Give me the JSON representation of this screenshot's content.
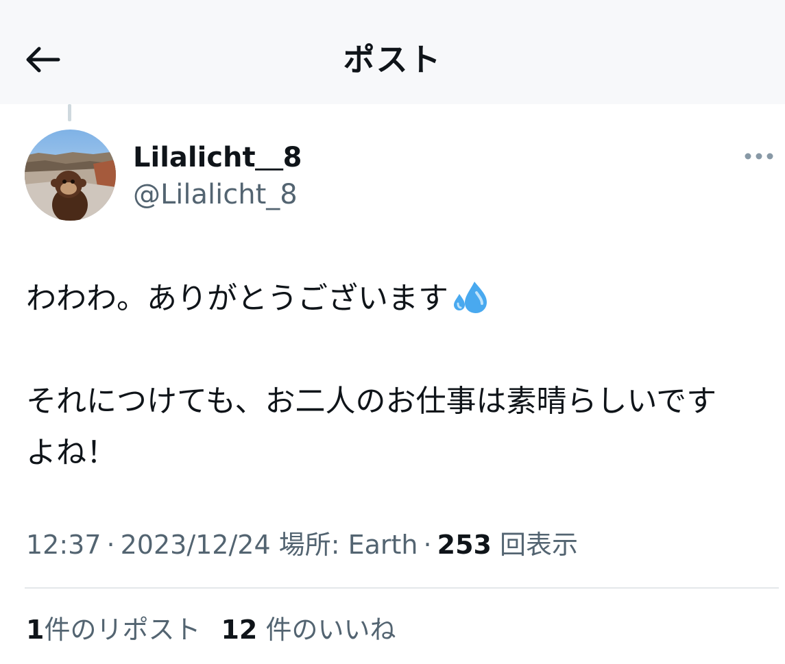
{
  "header": {
    "back_icon": "arrow-left-icon",
    "title": "ポスト"
  },
  "post": {
    "author": {
      "display_name": "Lilalicht＿8",
      "handle": "@Lilalicht_8",
      "avatar": "monkey-plush-at-canyon"
    },
    "more_icon": "more-horizontal-icon",
    "text_lines": [
      "わわわ。ありがとうございます",
      "",
      "それにつけても、お二人のお仕事は素晴らしいです",
      "よね！"
    ],
    "emoji": "sweat-droplets-emoji",
    "meta": {
      "time": "12:37",
      "separator": "·",
      "date": "2023/12/24",
      "location_label": "場所: Earth",
      "views_count": "253",
      "views_label": "回表示"
    },
    "stats": {
      "reposts_count": "1",
      "reposts_label": "件のリポスト",
      "likes_count": "12",
      "likes_label": "件のいいね"
    }
  },
  "colors": {
    "text_primary": "#0f1419",
    "text_secondary": "#536471",
    "divider": "#e4e7ea",
    "header_bg": "#f7f8fa"
  }
}
